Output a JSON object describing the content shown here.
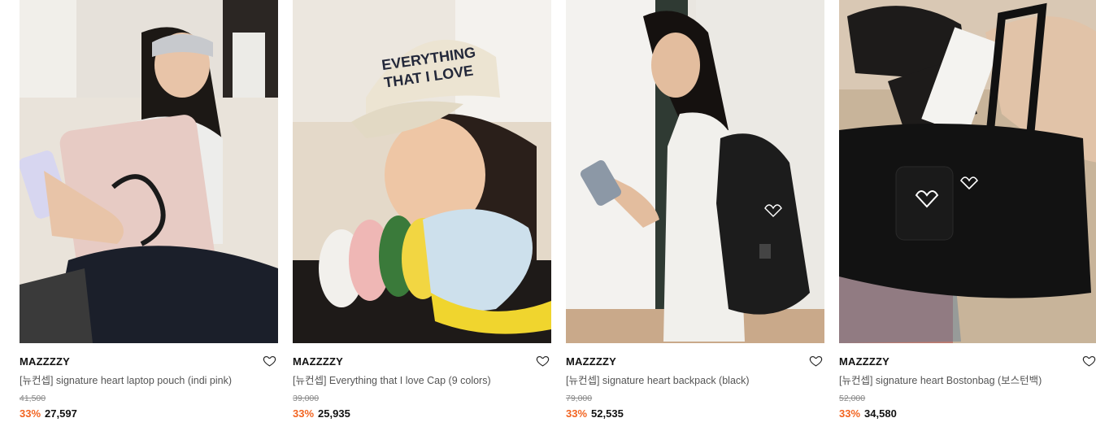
{
  "products": [
    {
      "brand": "MAZZZZY",
      "title": "[뉴컨셉] signature heart laptop pouch (indi pink)",
      "original_price": "41,500",
      "discount": "33%",
      "price": "27,597",
      "image_alt": "girl with headband holding pink laptop pouch and phone"
    },
    {
      "brand": "MAZZZZY",
      "title": "[뉴컨셉] Everything that I love Cap (9 colors)",
      "original_price": "39,000",
      "discount": "33%",
      "price": "25,935",
      "image_alt": "girl wearing beige cap with stack of colored caps",
      "cap_text_line1": "EVERYTHING",
      "cap_text_line2": "THAT I LOVE"
    },
    {
      "brand": "MAZZZZY",
      "title": "[뉴컨셉] signature heart backpack (black)",
      "original_price": "79,000",
      "discount": "33%",
      "price": "52,535",
      "image_alt": "girl looking at phone wearing black backpack"
    },
    {
      "brand": "MAZZZZY",
      "title": "[뉴컨셉] signature heart Bostonbag (보스턴백)",
      "original_price": "52,000",
      "discount": "33%",
      "price": "34,580",
      "image_alt": "black boston bag with heart pouch"
    }
  ],
  "colors": {
    "discount": "#f26522",
    "brand_text": "#111111",
    "title_text": "#555555",
    "strike_text": "#888888"
  },
  "icons": {
    "wishlist": "heart-outline-icon"
  }
}
